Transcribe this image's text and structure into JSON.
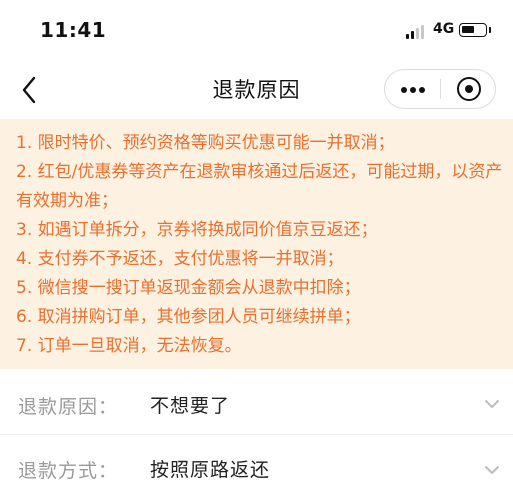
{
  "status_bar": {
    "time": "11:41",
    "network": "4G",
    "icons": [
      "signal-icon",
      "battery-icon"
    ]
  },
  "nav": {
    "title": "退款原因",
    "icons": [
      "back-icon",
      "more-icon",
      "close-icon"
    ]
  },
  "notice": {
    "color": "#e8702e",
    "background": "#fdf2e2",
    "items": [
      "1. 限时特价、预约资格等购买优惠可能一并取消；",
      "2. 红包/优惠券等资产在退款审核通过后返还，可能过期，以资产有效期为准；",
      "3. 如遇订单拆分，京券将换成同价值京豆返还；",
      "4. 支付券不予返还，支付优惠将一并取消；",
      "5. 微信搜一搜订单返现金额会从退款中扣除；",
      "6. 取消拼购订单，其他参团人员可继续拼单；",
      "7. 订单一旦取消，无法恢复。"
    ]
  },
  "form": {
    "reason": {
      "label": "退款原因：",
      "value": "不想要了"
    },
    "method": {
      "label": "退款方式：",
      "value": "按照原路返还"
    }
  }
}
